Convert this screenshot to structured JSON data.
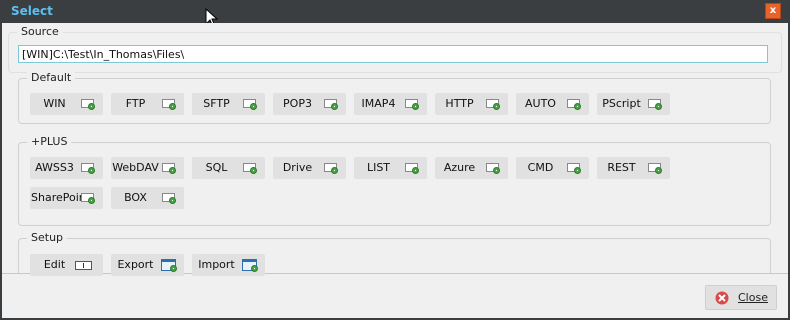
{
  "window": {
    "title": "Select",
    "close_glyph": "x"
  },
  "source": {
    "legend": "Source",
    "path": "[WIN]C:\\Test\\In_Thomas\\Files\\"
  },
  "default": {
    "legend": "Default",
    "buttons": [
      "WIN",
      "FTP",
      "SFTP",
      "POP3",
      "IMAP4",
      "HTTP",
      "AUTO",
      "PScript"
    ]
  },
  "plus": {
    "legend": "+PLUS",
    "buttons": [
      "AWSS3",
      "WebDAV",
      "SQL",
      "Drive",
      "LIST",
      "Azure",
      "CMD",
      "REST",
      "SharePoint",
      "BOX"
    ]
  },
  "setup": {
    "legend": "Setup",
    "buttons": [
      "Edit",
      "Export",
      "Import"
    ]
  },
  "footer": {
    "close_label": "Close"
  },
  "colors": {
    "title": "#5bc0f2",
    "accent_close": "#e8632a",
    "input_border": "#7ec8d8"
  }
}
